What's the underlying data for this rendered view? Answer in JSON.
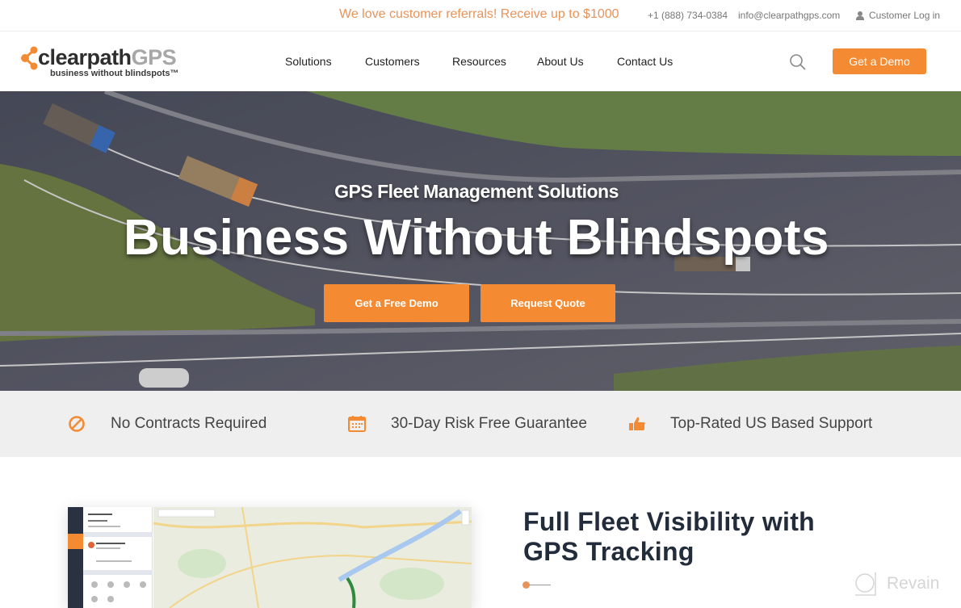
{
  "topbar": {
    "promo": "We love customer referrals! Receive up to $1000",
    "phone": "+1 (888) 734-0384",
    "email": "info@clearpathgps.com",
    "login": "Customer Log in",
    "login_icon": "user-icon"
  },
  "header": {
    "logo": {
      "name_main": "clearpath",
      "name_accent": "GPS",
      "tagline": "business without blindspots™"
    },
    "nav": [
      {
        "label": "Solutions"
      },
      {
        "label": "Customers"
      },
      {
        "label": "Resources"
      },
      {
        "label": "About Us"
      },
      {
        "label": "Contact Us"
      }
    ],
    "search_icon": "search-icon",
    "cta": "Get a Demo"
  },
  "hero": {
    "eyebrow": "GPS Fleet Management Solutions",
    "headline": "Business Without Blindspots",
    "buttons": [
      {
        "label": "Get a Free Demo"
      },
      {
        "label": "Request Quote"
      }
    ]
  },
  "features": [
    {
      "icon": "no-contract-icon",
      "label": "No Contracts Required"
    },
    {
      "icon": "calendar-icon",
      "label": "30-Day Risk Free Guarantee"
    },
    {
      "icon": "thumbs-up-icon",
      "label": "Top-Rated US Based Support"
    }
  ],
  "product": {
    "title_line1": "Full Fleet Visibility with",
    "title_line2": "GPS Tracking"
  },
  "watermark": "Revain",
  "colors": {
    "brand_orange": "#f48b33",
    "promo_text": "#e8935a",
    "heading_dark": "#222c3a",
    "strip_bg": "#efefef"
  }
}
